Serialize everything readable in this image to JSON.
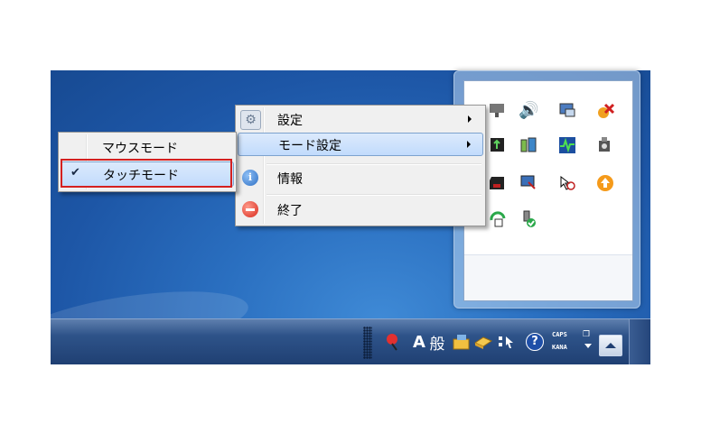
{
  "context_menu": {
    "items": [
      {
        "label": "設定",
        "icon": "gear-icon",
        "has_submenu": true
      },
      {
        "label": "モード設定",
        "icon": "",
        "has_submenu": true,
        "highlighted": true
      },
      {
        "label": "情報",
        "icon": "info-icon",
        "has_submenu": false
      },
      {
        "label": "終了",
        "icon": "stop-icon",
        "has_submenu": false
      }
    ]
  },
  "mode_submenu": {
    "items": [
      {
        "label": "マウスモード",
        "checked": false
      },
      {
        "label": "タッチモード",
        "checked": true,
        "highlighted": true
      }
    ],
    "check_glyph": "✔"
  },
  "taskbar": {
    "ime_mode": "A",
    "ime_kanji": "般",
    "caps_label": "CAPS",
    "kana_label": "KANA",
    "help_glyph": "?"
  },
  "colors": {
    "desktop": "#1d56a6",
    "highlight": "#c1dbfc",
    "callout_border": "#d42020"
  }
}
